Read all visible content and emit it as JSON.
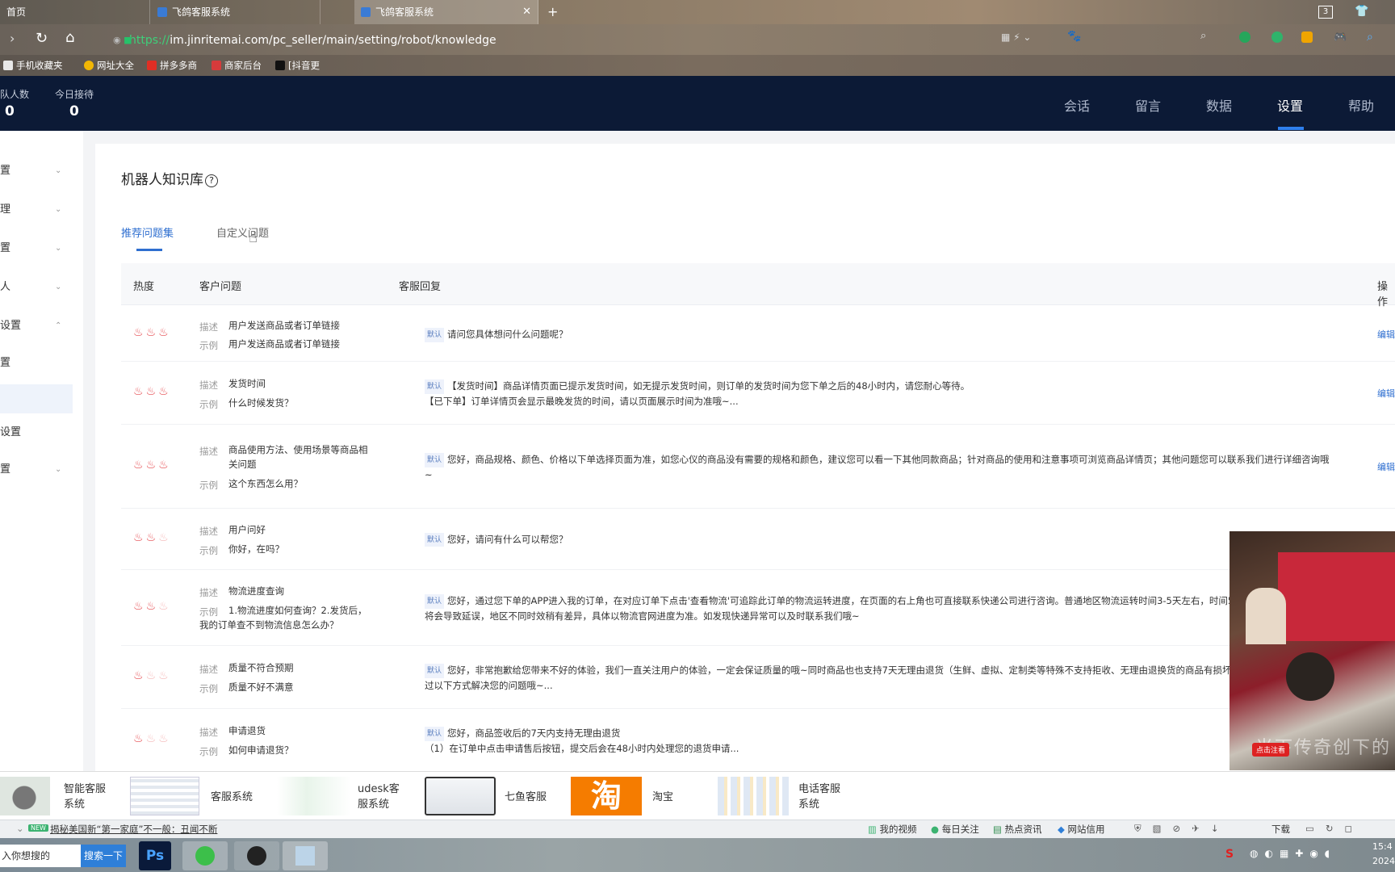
{
  "browser": {
    "tabs": [
      {
        "label": "首页"
      },
      {
        "label": "飞鸽客服系统"
      },
      {
        "label": "飞鸽客服系统"
      }
    ],
    "tab_count": "3",
    "url_scheme": "https://",
    "url": "im.jinritemai.com/pc_seller/main/setting/robot/knowledge",
    "bookmarks": [
      {
        "label": "手机收藏夹",
        "color": "#e8e8e8"
      },
      {
        "label": "网址大全",
        "color": "#f2b705"
      },
      {
        "label": "拼多多商",
        "color": "#e02e24"
      },
      {
        "label": "商家后台",
        "color": "#d63b3b"
      },
      {
        "label": "[抖音更",
        "color": "#111111"
      }
    ]
  },
  "header": {
    "stats": [
      {
        "label": "队人数",
        "value": "0"
      },
      {
        "label": "今日接待",
        "value": "0"
      }
    ],
    "nav": [
      "会话",
      "留言",
      "数据",
      "设置",
      "帮助"
    ],
    "active_nav": "设置",
    "accent": "#2f80ed"
  },
  "sidebar": {
    "items": [
      {
        "label": "置"
      },
      {
        "label": "理"
      },
      {
        "label": "置"
      },
      {
        "label": "人"
      },
      {
        "label": "设置"
      },
      {
        "label": "置"
      },
      {
        "label": ""
      },
      {
        "label": "设置"
      },
      {
        "label": "置"
      }
    ]
  },
  "main": {
    "title": "机器人知识库",
    "title_icon": "help-circle-icon",
    "tabs": [
      {
        "label": "推荐问题集",
        "active": true
      },
      {
        "label": "自定义问题",
        "active": false
      }
    ],
    "columns": [
      "热度",
      "客户问题",
      "客服回复",
      "操作"
    ],
    "desc_label": "描述",
    "example_label": "示例",
    "default_tag": "默认",
    "edit_label": "编辑",
    "rows": [
      {
        "heat": 3,
        "desc": "用户发送商品或者订单链接",
        "example": "用户发送商品或者订单链接",
        "reply": "请问您具体想问什么问题呢？"
      },
      {
        "heat": 3,
        "desc": "发货时间",
        "example": "什么时候发货？",
        "reply": "【发货时间】商品详情页面已提示发货时间，如无提示发货时间，则订单的发货时间为您下单之后的48小时内，请您耐心等待。\n【已下单】订单详情页会显示最晚发货的时间，请以页面展示时间为准哦~..."
      },
      {
        "heat": 3,
        "desc": "商品使用方法、使用场景等商品相关问题",
        "example": "这个东西怎么用？",
        "reply": "您好，商品规格、颜色、价格以下单选择页面为准，如您心仪的商品没有需要的规格和颜色，建议您可以看一下其他同款商品；针对商品的使用和注意事项可浏览商品详情页；其他问题您可以联系我们进行详细咨询哦~"
      },
      {
        "heat": 2,
        "desc": "用户问好",
        "example": "你好，在吗？",
        "reply": "您好，请问有什么可以帮您？"
      },
      {
        "heat": 2,
        "desc": "物流进度查询",
        "example": "1.物流进度如何查询？2.发货后，我的订单查不到物流信息怎么办？",
        "reply": "您好，通过您下单的APP进入我的订单，在对应订单下点击'查看物流'可追踪此订单的物流运转进度，在页面的右上角也可直接联系快递公司进行咨询。普通地区物流运转时间3-5天左右，时间5-7天左右，如遇特殊情况将会导致延误，地区不同时效稍有差异，具体以物流官网进度为准。如发现快递异常可以及时联系我们哦~"
      },
      {
        "heat": 1,
        "desc": "质量不符合预期",
        "example": "质量不好不满意",
        "reply": "您好，非常抱歉给您带来不好的体验，我们一直关注用户的体验，一定会保证质量的哦~同时商品也也支持7天无理由退货（生鲜、虚拟、定制类等特殊不支持拒收、无理由退换货的商品有损坏或不满意等问题，可以通过以下方式解决您的问题哦~..."
      },
      {
        "heat": 1,
        "desc": "申请退货",
        "example": "如何申请退货？",
        "reply": "您好，商品签收后的7天内支持无理由退货\n（1）在订单中点击申请售后按钮，提交后会在48小时内处理您的退货申请..."
      }
    ]
  },
  "video": {
    "caption": "光下传奇创下的",
    "button": "点击注看"
  },
  "ads": [
    {
      "label": "智能客服\n系统"
    },
    {
      "label": "客服系统"
    },
    {
      "label": "udesk客\n服系统"
    },
    {
      "label": "七鱼客服"
    },
    {
      "label": "淘宝",
      "glyph": "淘"
    },
    {
      "label": "电话客服\n系统"
    }
  ],
  "newsbar": {
    "badge": "NEW",
    "headline": "揭秘美国新“第一家庭”不一般：丑闻不断",
    "items": [
      "我的视频",
      "每日关注",
      "热点资讯",
      "网站信用",
      "下载"
    ]
  },
  "taskbar": {
    "search_placeholder": "入你想搜的",
    "search_button": "搜索一下",
    "clock": "15:4",
    "date": "2024"
  }
}
